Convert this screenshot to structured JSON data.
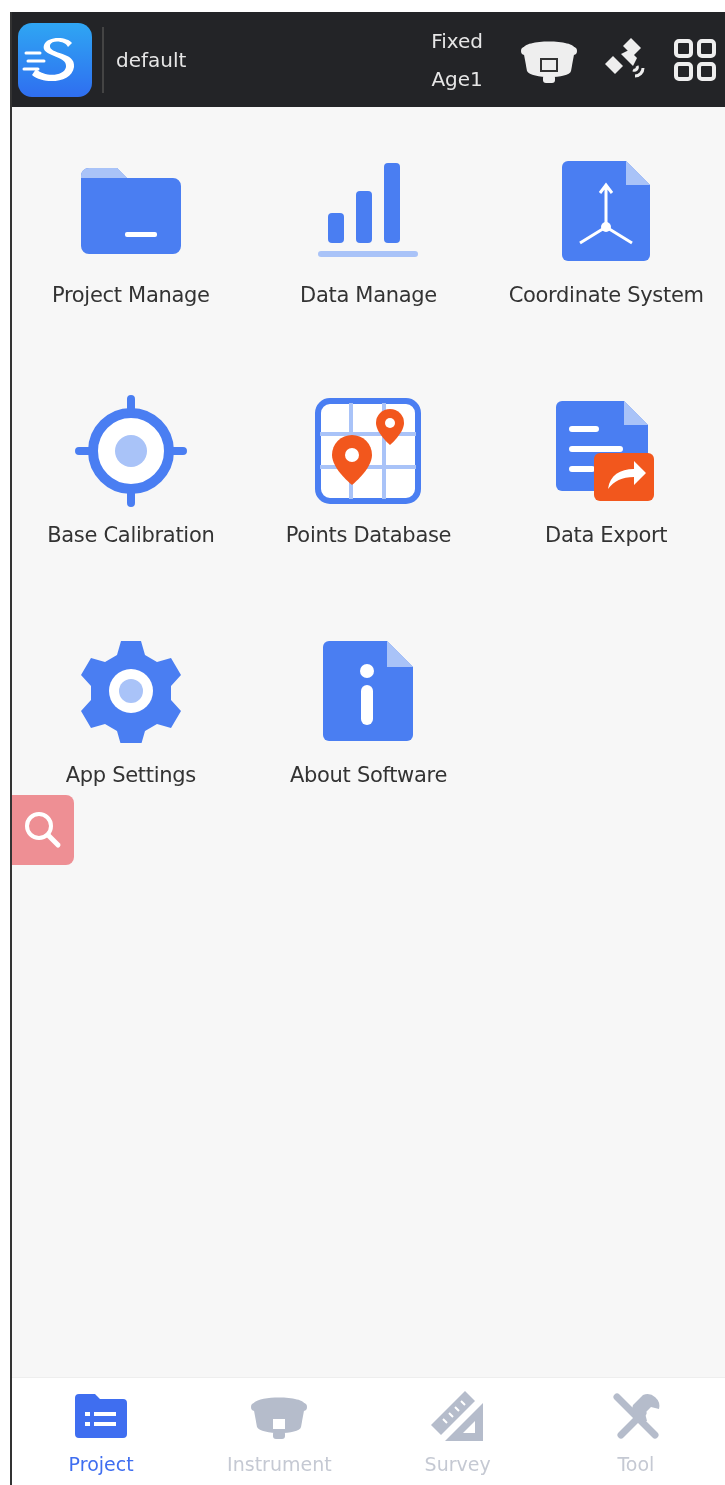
{
  "header": {
    "project": "default",
    "fix_status": "Fixed",
    "age": "Age1"
  },
  "tiles": [
    {
      "kind": "folder",
      "label": "Project Manage"
    },
    {
      "kind": "bars",
      "label": "Data Manage"
    },
    {
      "kind": "coords",
      "label": "Coordinate System"
    },
    {
      "kind": "target",
      "label": "Base Calibration"
    },
    {
      "kind": "map",
      "label": "Points Database"
    },
    {
      "kind": "export",
      "label": "Data Export"
    },
    {
      "kind": "gear",
      "label": "App Settings"
    },
    {
      "kind": "info",
      "label": "About Software"
    }
  ],
  "tabs": [
    {
      "kind": "project",
      "label": "Project",
      "selected": true
    },
    {
      "kind": "instrument",
      "label": "Instrument",
      "selected": false
    },
    {
      "kind": "survey",
      "label": "Survey",
      "selected": false
    },
    {
      "kind": "tool",
      "label": "Tool",
      "selected": false
    }
  ]
}
